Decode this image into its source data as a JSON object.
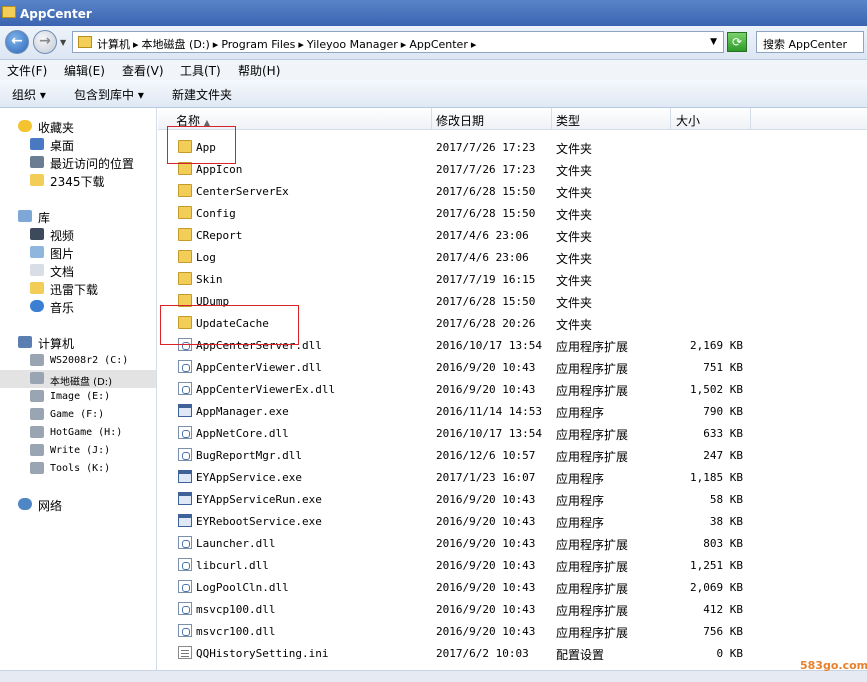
{
  "window": {
    "title": "AppCenter"
  },
  "address": {
    "crumbs": [
      "计算机",
      "▸",
      "本地磁盘 (D:)",
      "▸",
      "Program Files",
      "▸",
      "Yileyoo Manager",
      "▸",
      "AppCenter",
      "▸"
    ],
    "search_placeholder": "搜索 AppCenter"
  },
  "menu": [
    "文件(F)",
    "编辑(E)",
    "查看(V)",
    "工具(T)",
    "帮助(H)"
  ],
  "toolbar": {
    "organize": "组织 ▾",
    "include": "包含到库中 ▾",
    "new_folder": "新建文件夹"
  },
  "nav": {
    "favorites": {
      "label": "收藏夹",
      "items": [
        "桌面",
        "最近访问的位置",
        "2345下载"
      ]
    },
    "libraries": {
      "label": "库",
      "items": [
        "视频",
        "图片",
        "文档",
        "迅雷下载",
        "音乐"
      ]
    },
    "computer": {
      "label": "计算机",
      "items": [
        "WS2008r2 (C:)",
        "本地磁盘 (D:)",
        "Image (E:)",
        "Game (F:)",
        "HotGame (H:)",
        "Write (J:)",
        "Tools (K:)"
      ]
    },
    "network": {
      "label": "网络"
    }
  },
  "columns": {
    "name": "名称",
    "date": "修改日期",
    "type": "类型",
    "size": "大小"
  },
  "files": [
    {
      "name": "App",
      "date": "2017/7/26 17:23",
      "type": "文件夹",
      "size": "",
      "icon": "folder"
    },
    {
      "name": "AppIcon",
      "date": "2017/7/26 17:23",
      "type": "文件夹",
      "size": "",
      "icon": "folder"
    },
    {
      "name": "CenterServerEx",
      "date": "2017/6/28 15:50",
      "type": "文件夹",
      "size": "",
      "icon": "folder"
    },
    {
      "name": "Config",
      "date": "2017/6/28 15:50",
      "type": "文件夹",
      "size": "",
      "icon": "folder"
    },
    {
      "name": "CReport",
      "date": "2017/4/6 23:06",
      "type": "文件夹",
      "size": "",
      "icon": "folder"
    },
    {
      "name": "Log",
      "date": "2017/4/6 23:06",
      "type": "文件夹",
      "size": "",
      "icon": "folder"
    },
    {
      "name": "Skin",
      "date": "2017/7/19 16:15",
      "type": "文件夹",
      "size": "",
      "icon": "folder"
    },
    {
      "name": "UDump",
      "date": "2017/6/28 15:50",
      "type": "文件夹",
      "size": "",
      "icon": "folder"
    },
    {
      "name": "UpdateCache",
      "date": "2017/6/28 20:26",
      "type": "文件夹",
      "size": "",
      "icon": "folder"
    },
    {
      "name": "AppCenterServer.dll",
      "date": "2016/10/17 13:54",
      "type": "应用程序扩展",
      "size": "2,169 KB",
      "icon": "dll"
    },
    {
      "name": "AppCenterViewer.dll",
      "date": "2016/9/20 10:43",
      "type": "应用程序扩展",
      "size": "751 KB",
      "icon": "dll"
    },
    {
      "name": "AppCenterViewerEx.dll",
      "date": "2016/9/20 10:43",
      "type": "应用程序扩展",
      "size": "1,502 KB",
      "icon": "dll"
    },
    {
      "name": "AppManager.exe",
      "date": "2016/11/14 14:53",
      "type": "应用程序",
      "size": "790 KB",
      "icon": "exe"
    },
    {
      "name": "AppNetCore.dll",
      "date": "2016/10/17 13:54",
      "type": "应用程序扩展",
      "size": "633 KB",
      "icon": "dll"
    },
    {
      "name": "BugReportMgr.dll",
      "date": "2016/12/6 10:57",
      "type": "应用程序扩展",
      "size": "247 KB",
      "icon": "dll"
    },
    {
      "name": "EYAppService.exe",
      "date": "2017/1/23 16:07",
      "type": "应用程序",
      "size": "1,185 KB",
      "icon": "exe"
    },
    {
      "name": "EYAppServiceRun.exe",
      "date": "2016/9/20 10:43",
      "type": "应用程序",
      "size": "58 KB",
      "icon": "exe"
    },
    {
      "name": "EYRebootService.exe",
      "date": "2016/9/20 10:43",
      "type": "应用程序",
      "size": "38 KB",
      "icon": "exe"
    },
    {
      "name": "Launcher.dll",
      "date": "2016/9/20 10:43",
      "type": "应用程序扩展",
      "size": "803 KB",
      "icon": "dll"
    },
    {
      "name": "libcurl.dll",
      "date": "2016/9/20 10:43",
      "type": "应用程序扩展",
      "size": "1,251 KB",
      "icon": "dll"
    },
    {
      "name": "LogPoolCln.dll",
      "date": "2016/9/20 10:43",
      "type": "应用程序扩展",
      "size": "2,069 KB",
      "icon": "dll"
    },
    {
      "name": "msvcp100.dll",
      "date": "2016/9/20 10:43",
      "type": "应用程序扩展",
      "size": "412 KB",
      "icon": "dll"
    },
    {
      "name": "msvcr100.dll",
      "date": "2016/9/20 10:43",
      "type": "应用程序扩展",
      "size": "756 KB",
      "icon": "dll"
    },
    {
      "name": "QQHistorySetting.ini",
      "date": "2017/6/2 10:03",
      "type": "配置设置",
      "size": "0 KB",
      "icon": "ini"
    }
  ],
  "watermark": "583go.com",
  "colors": {
    "highlight": "#d9232a",
    "folder": "#f2cd58",
    "selection": "#e3e3e3"
  }
}
